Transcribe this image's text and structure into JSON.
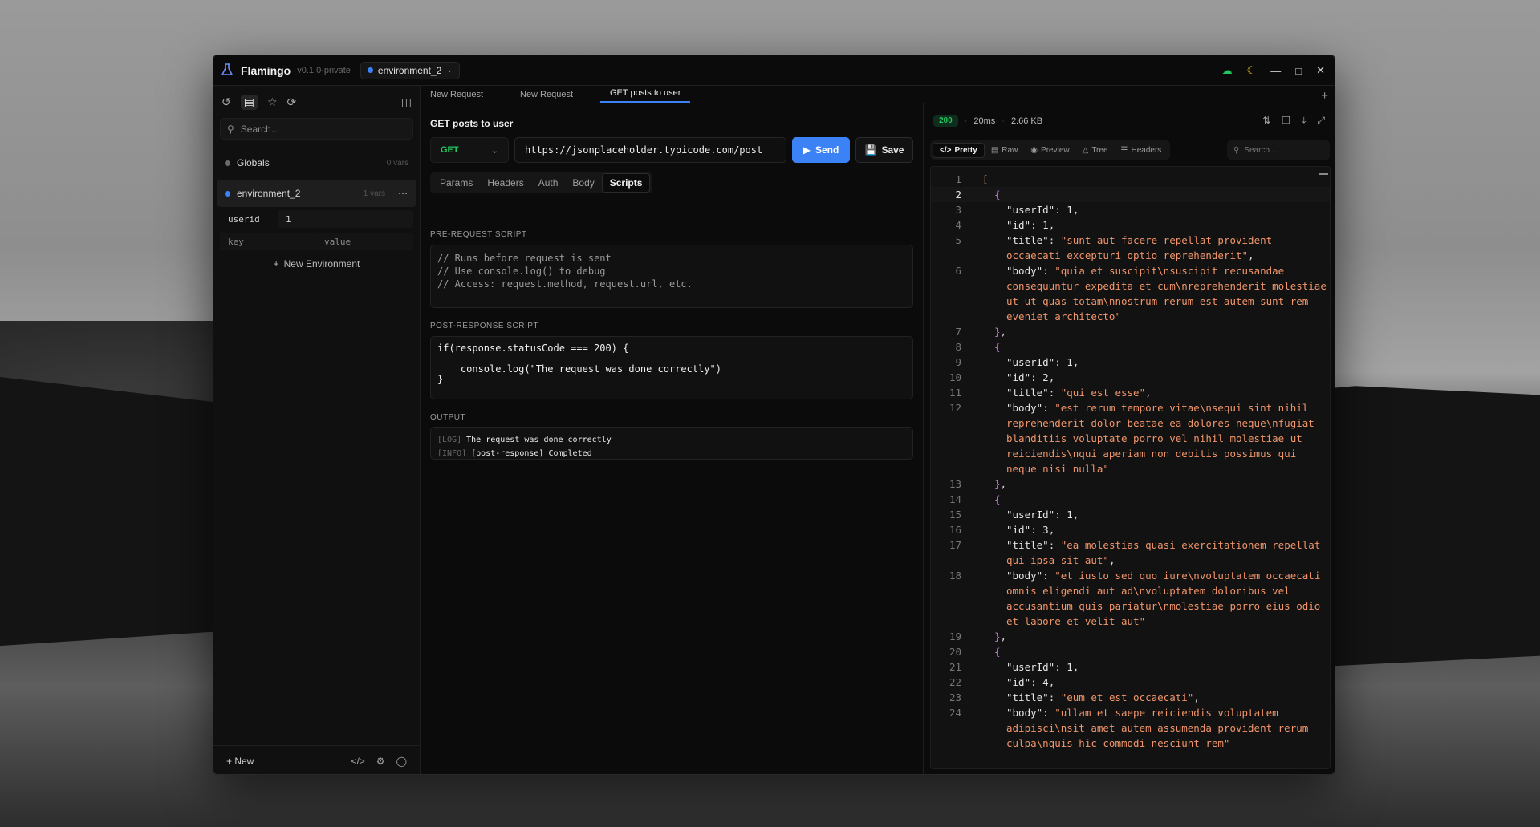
{
  "app": {
    "title": "Flamingo",
    "version": "v0.1.0-private",
    "env": "environment_2"
  },
  "sidebar": {
    "search_placeholder": "Search...",
    "globals": {
      "name": "Globals",
      "meta": "0 vars"
    },
    "environment": {
      "name": "environment_2",
      "meta": "1 vars",
      "more": "⋯"
    },
    "vars": [
      {
        "key": "userid",
        "value": "1"
      }
    ],
    "key_placeholder": "key",
    "value_placeholder": "value",
    "new_env": "New Environment",
    "new_label": "New"
  },
  "tabs": [
    "New Request",
    "New Request",
    "GET posts to user"
  ],
  "request": {
    "title": "GET posts to user",
    "method": "GET",
    "url": "https://jsonplaceholder.typicode.com/post",
    "send": "Send",
    "save": "Save",
    "subtabs": [
      "Params",
      "Headers",
      "Auth",
      "Body",
      "Scripts"
    ],
    "pre_label": "PRE-REQUEST SCRIPT",
    "pre_lines": [
      "// Runs before request is sent",
      "// Use console.log() to debug",
      "// Access: request.method, request.url, etc."
    ],
    "post_label": "POST-RESPONSE SCRIPT",
    "post_lines": [
      "if(response.statusCode === 200) {",
      "",
      "    console.log(\"The request was done correctly\")",
      "}"
    ],
    "output_label": "OUTPUT",
    "output": [
      {
        "level": "[LOG]",
        "msg": "The request was done correctly"
      },
      {
        "level": "[INFO]",
        "msg": "[post-response] Completed"
      }
    ]
  },
  "response": {
    "status": "200",
    "time": "20ms",
    "size": "2.66 KB",
    "views": [
      "Pretty",
      "Raw",
      "Preview",
      "Tree",
      "Headers"
    ],
    "search_placeholder": "Search...",
    "line_numbers": [
      "1",
      "2",
      "3",
      "4",
      "5",
      "",
      "6",
      "",
      "",
      "",
      "7",
      "8",
      "9",
      "10",
      "11",
      "12",
      "",
      "",
      "",
      "",
      "13",
      "14",
      "15",
      "16",
      "17",
      "",
      "18",
      "",
      "",
      "",
      "",
      "19",
      "20",
      "21",
      "22",
      "23",
      "24",
      ""
    ],
    "posts": [
      {
        "userId": "1",
        "id": "1",
        "title": "sunt aut facere repellat provident occaecati excepturi optio reprehenderit",
        "body": "quia et suscipit\\nsuscipit recusandae consequuntur expedita et cum\\nreprehenderit molestiae ut ut quas totam\\nnostrum rerum est autem sunt rem eveniet architecto"
      },
      {
        "userId": "1",
        "id": "2",
        "title": "qui est esse",
        "body": "est rerum tempore vitae\\nsequi sint nihil reprehenderit dolor beatae ea dolores neque\\nfugiat blanditiis voluptate porro vel nihil molestiae ut reiciendis\\nqui aperiam non debitis possimus qui neque nisi nulla"
      },
      {
        "userId": "1",
        "id": "3",
        "title": "ea molestias quasi exercitationem repellat qui ipsa sit aut",
        "body": "et iusto sed quo iure\\nvoluptatem occaecati omnis eligendi aut ad\\nvoluptatem doloribus vel accusantium quis pariatur\\nmolestiae porro eius odio et labore et velit aut"
      },
      {
        "userId": "1",
        "id": "4",
        "title": "eum et est occaecati",
        "body": "ullam et saepe reiciendis voluptatem adipisci\\nsit amet autem assumenda provident rerum culpa\\nquis hic commodi nesciunt rem"
      }
    ]
  },
  "colors": {
    "accent": "#3b82f6",
    "get": "#22c55e",
    "string": "#f0956a",
    "bracket": "#e5c07b",
    "brace": "#c678dd"
  }
}
